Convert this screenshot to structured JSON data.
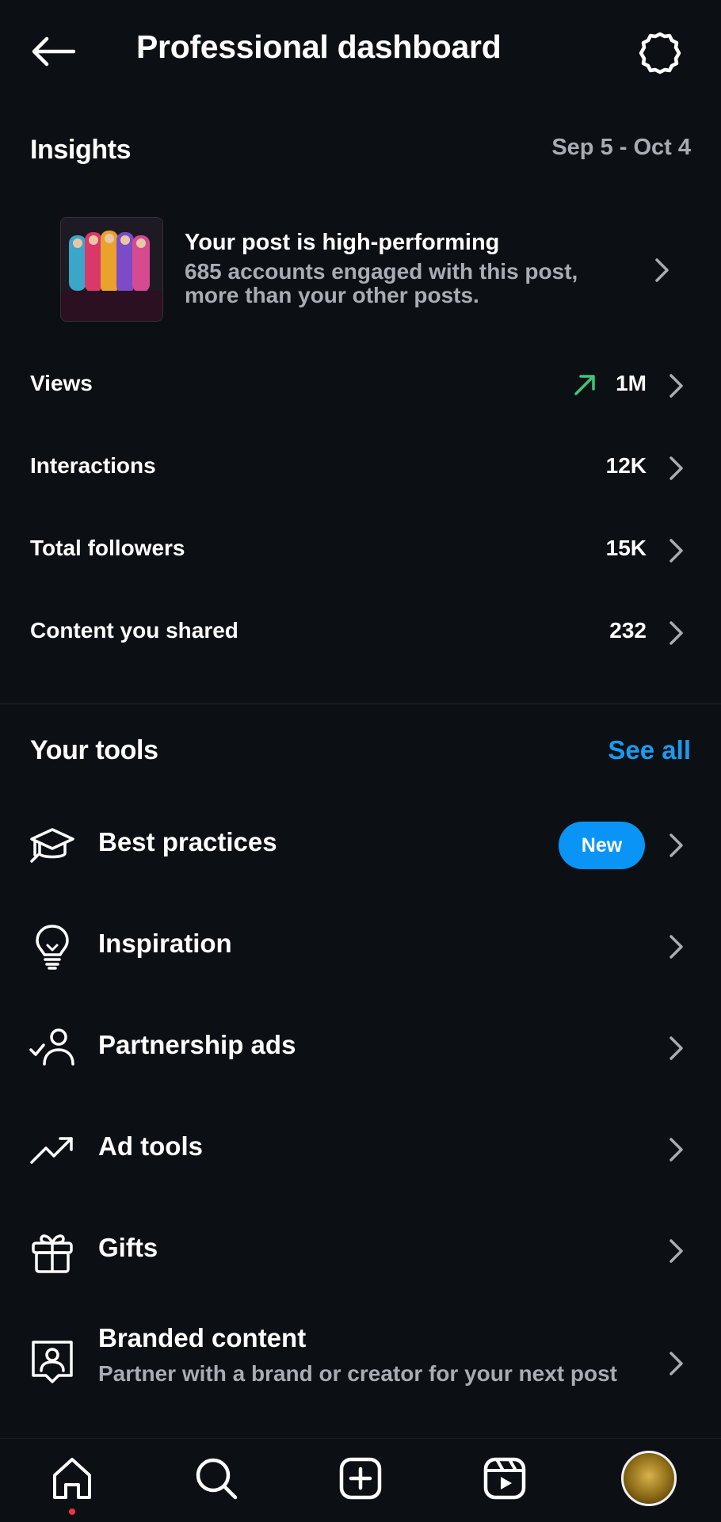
{
  "header": {
    "title": "Professional dashboard",
    "back_icon": "arrow-left-icon",
    "settings_icon": "settings-icon"
  },
  "insights": {
    "title": "Insights",
    "date_range": "Sep 5 - Oct 4",
    "post": {
      "title": "Your post is high-performing",
      "description": "685 accounts engaged with this post, more than your other posts."
    },
    "metrics": [
      {
        "label": "Views",
        "value": "1M",
        "trend": "up",
        "trend_color": "#3cc67a"
      },
      {
        "label": "Interactions",
        "value": "12K"
      },
      {
        "label": "Total followers",
        "value": "15K"
      },
      {
        "label": "Content you shared",
        "value": "232"
      }
    ]
  },
  "tools": {
    "title": "Your tools",
    "see_all": "See all",
    "items": [
      {
        "label": "Best practices",
        "icon": "graduation-cap-icon",
        "badge": "New"
      },
      {
        "label": "Inspiration",
        "icon": "lightbulb-icon"
      },
      {
        "label": "Partnership ads",
        "icon": "person-check-icon"
      },
      {
        "label": "Ad tools",
        "icon": "trending-up-icon"
      },
      {
        "label": "Gifts",
        "icon": "gift-icon"
      },
      {
        "label": "Branded content",
        "icon": "branded-content-icon",
        "subtitle": "Partner with a brand or creator for your next post"
      }
    ]
  },
  "nav": {
    "items": [
      "home-icon",
      "search-icon",
      "create-icon",
      "reels-icon",
      "profile-avatar"
    ]
  },
  "colors": {
    "background": "#0c1014",
    "accent": "#1a9bf0",
    "badge": "#0a95f6",
    "secondary_text": "#a8acb3"
  }
}
